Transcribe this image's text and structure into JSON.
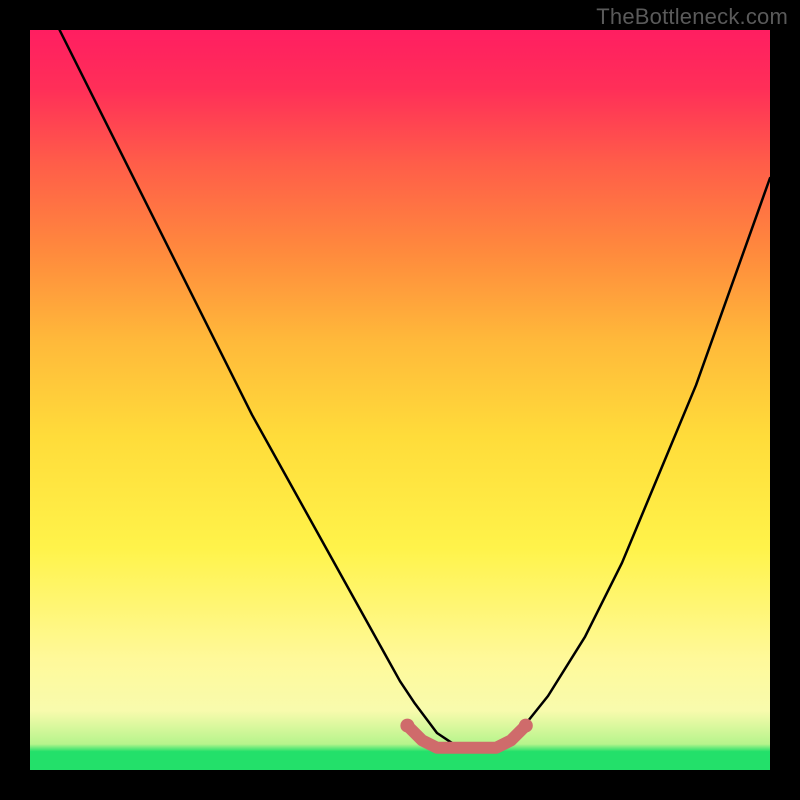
{
  "watermark": "TheBottleneck.com",
  "chart_data": {
    "type": "line",
    "title": "",
    "xlabel": "",
    "ylabel": "",
    "xlim": [
      0,
      100
    ],
    "ylim": [
      0,
      100
    ],
    "series": [
      {
        "name": "curve",
        "x": [
          4,
          10,
          15,
          20,
          25,
          30,
          35,
          40,
          45,
          50,
          52,
          55,
          58,
          60,
          63,
          66,
          70,
          75,
          80,
          85,
          90,
          95,
          100
        ],
        "values": [
          100,
          88,
          78,
          68,
          58,
          48,
          39,
          30,
          21,
          12,
          9,
          5,
          3,
          3,
          3,
          5,
          10,
          18,
          28,
          40,
          52,
          66,
          80
        ]
      },
      {
        "name": "optimal-band",
        "x": [
          51,
          53,
          55,
          57,
          59,
          61,
          63,
          65,
          67
        ],
        "values": [
          6,
          4,
          3,
          3,
          3,
          3,
          3,
          4,
          6
        ]
      }
    ],
    "colors": {
      "curve": "#000000",
      "optimal_band": "#cf6b6b",
      "gradient_top": "#ff1e61",
      "gradient_bottom": "#23e06a"
    },
    "annotations": []
  }
}
